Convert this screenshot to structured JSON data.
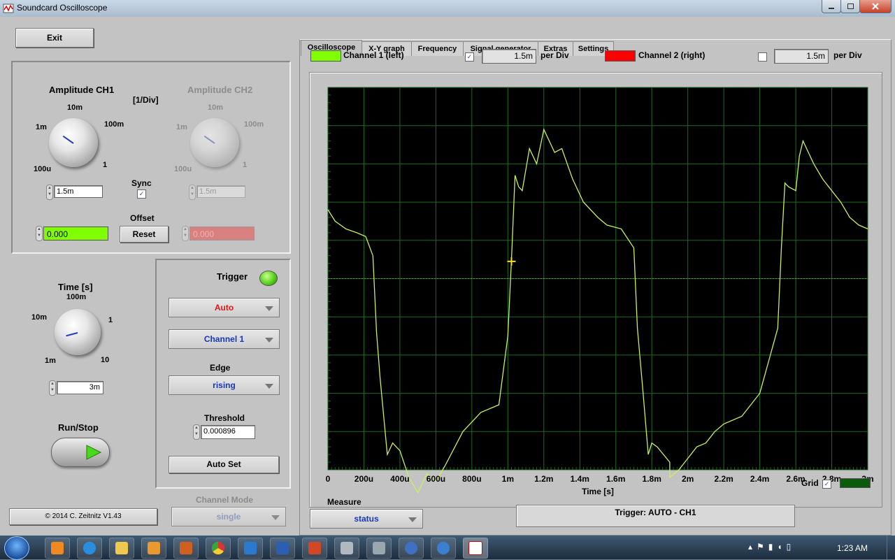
{
  "window": {
    "title": "Soundcard Oscilloscope"
  },
  "exit_label": "Exit",
  "ch1": {
    "title": "Amplitude CH1",
    "unit_label": "[1/Div]",
    "dial": [
      "10m",
      "1m",
      "100m",
      "100u",
      "1"
    ],
    "value": "1.5m",
    "sync_label": "Sync",
    "offset_label": "Offset",
    "offset_value": "0.000",
    "reset_label": "Reset"
  },
  "ch2": {
    "title": "Amplitude CH2",
    "dial": [
      "10m",
      "1m",
      "100m",
      "100u",
      "1"
    ],
    "value": "1.5m",
    "offset_value": "0.000"
  },
  "time": {
    "title": "Time [s]",
    "dial": [
      "100m",
      "10m",
      "1",
      "1m",
      "10"
    ],
    "value": "3m"
  },
  "runstop_label": "Run/Stop",
  "trigger": {
    "title": "Trigger",
    "mode": "Auto",
    "channel": "Channel 1",
    "edge_label": "Edge",
    "edge": "rising",
    "threshold_label": "Threshold",
    "threshold": "0.000896",
    "autoset_label": "Auto Set"
  },
  "copyright": "© 2014  C. Zeitnitz V1.43",
  "channel_mode": {
    "label": "Channel Mode",
    "value": "single"
  },
  "tabs": [
    "Oscilloscope",
    "X-Y graph",
    "Frequency",
    "Signal generator",
    "Extras",
    "Settings"
  ],
  "legend": {
    "ch1_label": "Channel 1 (left)",
    "ch1_div": "1.5m",
    "per_div": "per Div",
    "ch2_label": "Channel 2 (right)",
    "ch2_div": "1.5m"
  },
  "colors": {
    "ch1": "#80ff00",
    "ch2": "#ff0000",
    "grid": "#1e6a1e",
    "trace": "#c8f060"
  },
  "chart_data": {
    "type": "line",
    "xlabel": "Time [s]",
    "xlim": [
      0,
      0.003
    ],
    "x_ticks": [
      "0",
      "200u",
      "400u",
      "600u",
      "800u",
      "1m",
      "1.2m",
      "1.4m",
      "1.6m",
      "1.8m",
      "2m",
      "2.2m",
      "2.4m",
      "2.6m",
      "2.8m",
      "3m"
    ],
    "ylim": [
      -5,
      5
    ],
    "series": [
      {
        "x": [
          0,
          4e-05,
          0.0001,
          0.00016,
          0.00021,
          0.00025,
          0.00027,
          0.00029,
          0.00033,
          0.00036,
          0.0004,
          0.00045,
          0.0005,
          0.00055,
          0.0006,
          0.00065,
          0.00075,
          0.00085,
          0.00095,
          0.001,
          0.00102,
          0.00104,
          0.00106,
          0.00108,
          0.00112,
          0.00116,
          0.0012,
          0.00126,
          0.0013,
          0.00136,
          0.00142,
          0.0015,
          0.00155,
          0.00163,
          0.0017,
          0.00172,
          0.00175,
          0.00178,
          0.0018,
          0.00183,
          0.0019,
          0.0019,
          0.00195,
          0.002,
          0.00205,
          0.0021,
          0.00215,
          0.0022,
          0.0023,
          0.0024,
          0.0025,
          0.00252,
          0.00254,
          0.00256,
          0.0026,
          0.00262,
          0.00264,
          0.00268,
          0.0027,
          0.00275,
          0.0028,
          0.00285,
          0.0029,
          0.00295,
          0.003
        ],
        "y": [
          1.8,
          1.5,
          1.3,
          1.2,
          1.1,
          0.6,
          -1.4,
          -2.6,
          -4.6,
          -4.3,
          -4.5,
          -5.2,
          -5.6,
          -5.1,
          -5.3,
          -4.9,
          -4.0,
          -3.5,
          -3.3,
          -1.5,
          0.5,
          2.7,
          2.4,
          2.3,
          3.4,
          3.0,
          3.9,
          3.3,
          3.4,
          2.6,
          2.0,
          1.6,
          1.4,
          1.3,
          0.8,
          -1.3,
          -2.9,
          -4.6,
          -4.3,
          -4.4,
          -4.8,
          -5.2,
          -5.0,
          -4.7,
          -4.4,
          -4.3,
          -4.0,
          -3.8,
          -3.6,
          -3.0,
          -1.3,
          0.8,
          2.5,
          2.4,
          2.3,
          3.2,
          3.6,
          3.2,
          3.0,
          2.6,
          2.3,
          2.0,
          1.6,
          1.4,
          1.3
        ]
      }
    ],
    "grid": true,
    "grid_label": "Grid"
  },
  "measure": {
    "label": "Measure",
    "value": "status"
  },
  "status_text": "Trigger: AUTO - CH1",
  "clock": "1:23 AM"
}
